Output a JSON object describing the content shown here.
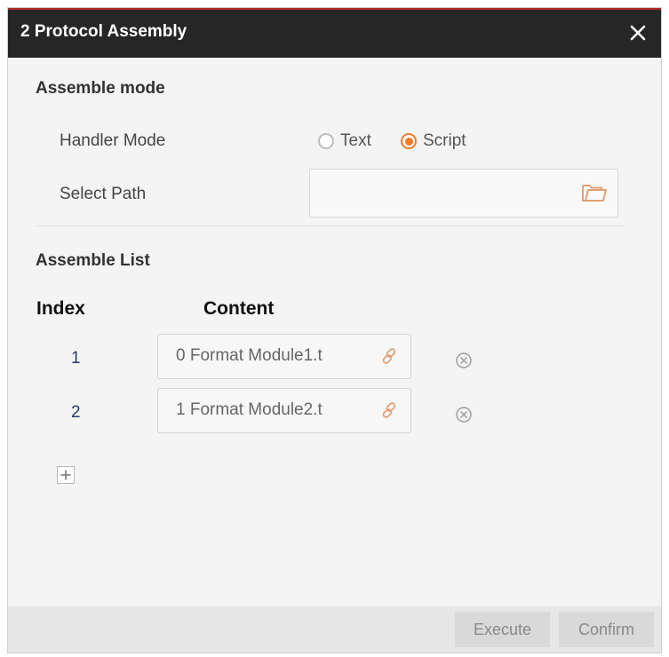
{
  "dialog": {
    "title": "2 Protocol Assembly"
  },
  "assemble_mode": {
    "heading": "Assemble mode",
    "handler_mode_label": "Handler Mode",
    "options": [
      {
        "label": "Text",
        "selected": false
      },
      {
        "label": "Script",
        "selected": true
      }
    ],
    "select_path_label": "Select Path",
    "select_path_value": ""
  },
  "assemble_list": {
    "heading": "Assemble List",
    "columns": {
      "index": "Index",
      "content": "Content"
    },
    "rows": [
      {
        "index": "1",
        "content": "0 Format Module1.t"
      },
      {
        "index": "2",
        "content": "1 Format Module2.t"
      }
    ]
  },
  "footer": {
    "execute_label": "Execute",
    "confirm_label": "Confirm"
  },
  "colors": {
    "accent": "#f07a2a",
    "titlebar": "#262626",
    "title_border": "#b02a2a"
  },
  "icons": [
    "close-icon",
    "folder-icon",
    "link-icon",
    "remove-icon",
    "plus-icon"
  ]
}
